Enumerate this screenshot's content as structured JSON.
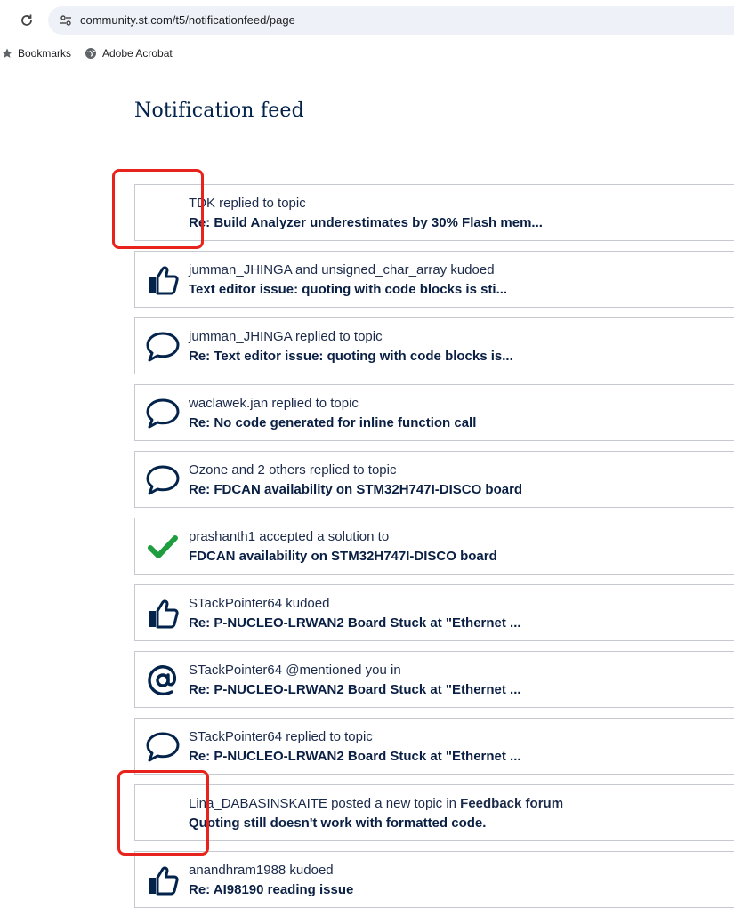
{
  "browser": {
    "url": "community.st.com/t5/notificationfeed/page",
    "bookmarks": [
      {
        "label": "Bookmarks",
        "icon": "star-icon"
      },
      {
        "label": "Adobe Acrobat",
        "icon": "globe-icon"
      }
    ]
  },
  "page": {
    "title": "Notification feed"
  },
  "notifications": [
    {
      "icon": "none",
      "line1": "TDK replied to topic",
      "line1_bold": "",
      "line2": "Re: Build Analyzer underestimates by 30% Flash mem..."
    },
    {
      "icon": "thumbs-up-icon",
      "line1": "jumman_JHINGA and unsigned_char_array kudoed",
      "line1_bold": "",
      "line2": "Text editor issue: quoting with code blocks is sti..."
    },
    {
      "icon": "speech-bubble-icon",
      "line1": "jumman_JHINGA replied to topic",
      "line1_bold": "",
      "line2": "Re: Text editor issue: quoting with code blocks is..."
    },
    {
      "icon": "speech-bubble-icon",
      "line1": "waclawek.jan replied to topic",
      "line1_bold": "",
      "line2": "Re: No code generated for inline function call"
    },
    {
      "icon": "speech-bubble-icon",
      "line1": "Ozone and 2 others replied to topic",
      "line1_bold": "",
      "line2": "Re: FDCAN availability on STM32H747I-DISCO board"
    },
    {
      "icon": "checkmark-icon",
      "line1": "prashanth1 accepted a solution to",
      "line1_bold": "",
      "line2": "FDCAN availability on STM32H747I-DISCO board"
    },
    {
      "icon": "thumbs-up-icon",
      "line1": "STackPointer64 kudoed",
      "line1_bold": "",
      "line2": "Re: P-NUCLEO-LRWAN2 Board Stuck at \"Ethernet ..."
    },
    {
      "icon": "at-sign-icon",
      "line1": "STackPointer64 @mentioned you in",
      "line1_bold": "",
      "line2": "Re: P-NUCLEO-LRWAN2 Board Stuck at \"Ethernet ..."
    },
    {
      "icon": "speech-bubble-icon",
      "line1": "STackPointer64 replied to topic",
      "line1_bold": "",
      "line2": "Re: P-NUCLEO-LRWAN2 Board Stuck at \"Ethernet ..."
    },
    {
      "icon": "none",
      "line1": "Lina_DABASINSKAITE posted a new topic in ",
      "line1_bold": "Feedback forum",
      "line2": "Quoting still doesn't work with formatted code."
    },
    {
      "icon": "thumbs-up-icon",
      "line1": "anandhram1988 kudoed",
      "line1_bold": "",
      "line2": "Re: AI98190 reading issue"
    }
  ],
  "colors": {
    "icon": "#03234b",
    "check": "#1e9e3e",
    "highlight": "#e8231d"
  }
}
